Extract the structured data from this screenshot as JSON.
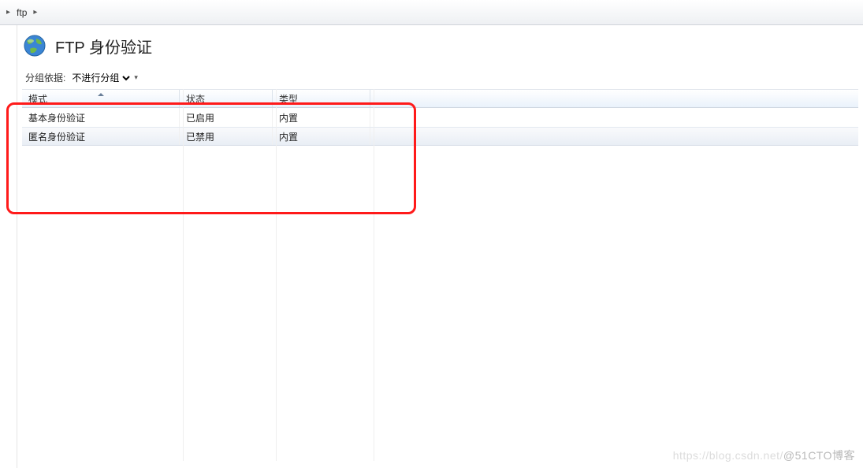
{
  "breadcrumb": {
    "item": "ftp"
  },
  "page": {
    "title": "FTP 身份验证"
  },
  "grouping": {
    "label": "分组依据:",
    "value": "不进行分组"
  },
  "table": {
    "headers": {
      "mode": "模式",
      "status": "状态",
      "type": "类型"
    },
    "rows": [
      {
        "mode": "基本身份验证",
        "status": "已启用",
        "type": "内置",
        "selected": false
      },
      {
        "mode": "匿名身份验证",
        "status": "已禁用",
        "type": "内置",
        "selected": true
      }
    ]
  },
  "watermark": {
    "faint": "https://blog.csdn.net/",
    "text": "@51CTO博客"
  }
}
